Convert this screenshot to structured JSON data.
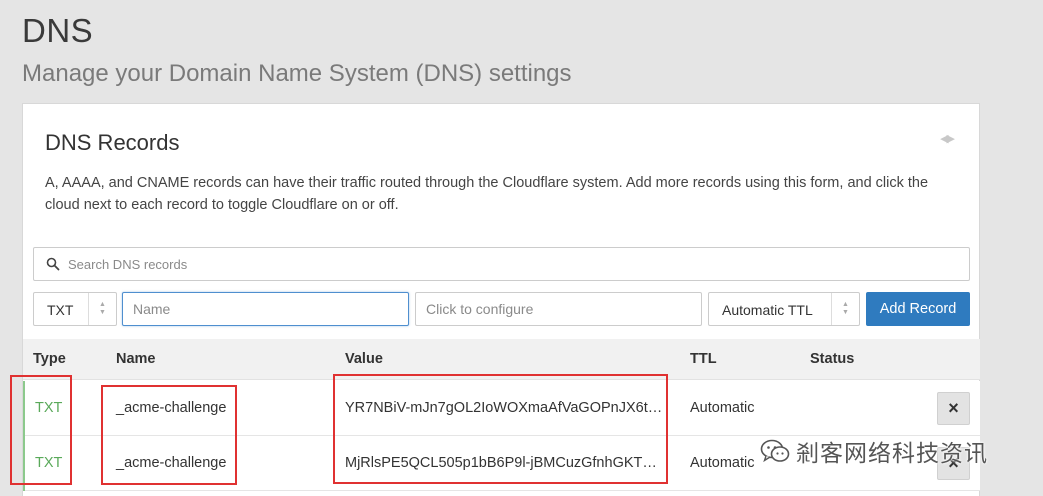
{
  "page": {
    "title": "DNS",
    "subtitle": "Manage your Domain Name System (DNS) settings"
  },
  "card": {
    "title": "DNS Records",
    "collapse_icon": "collapse-arrows-icon",
    "description": "A, AAAA, and CNAME records can have their traffic routed through the Cloudflare system. Add more records using this form, and click the cloud next to each record to toggle Cloudflare on or off."
  },
  "search": {
    "placeholder": "Search DNS records",
    "icon": "search-icon"
  },
  "form": {
    "type_value": "TXT",
    "name_placeholder": "Name",
    "content_placeholder": "Click to configure",
    "ttl_value": "Automatic TTL",
    "add_label": "Add Record",
    "add_color": "#2f7bbf"
  },
  "table": {
    "columns": [
      "Type",
      "Name",
      "Value",
      "TTL",
      "Status"
    ],
    "rows": [
      {
        "type": "TXT",
        "name": "_acme-challenge",
        "value": "YR7NBiV-mJn7gOL2IoWOXmaAfVaGOPnJX6t…",
        "ttl": "Automatic",
        "delete": "×"
      },
      {
        "type": "TXT",
        "name": "_acme-challenge",
        "value": "MjRlsPE5QCL505p1bB6P9l-jBMCuzGfnhGKT…",
        "ttl": "Automatic",
        "delete": "×"
      }
    ]
  },
  "colors": {
    "accent_green": "#5aa95a",
    "highlight_red": "#e03131"
  },
  "watermark": {
    "text": "剎客网络科技资讯",
    "icon": "wechat-icon"
  }
}
